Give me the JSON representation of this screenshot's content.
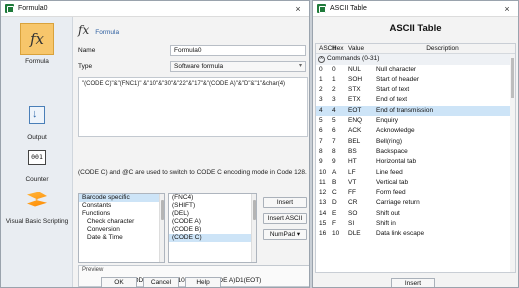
{
  "formula_window": {
    "title": "Formula0",
    "close": "×",
    "rail": [
      {
        "label": "Formula"
      },
      {
        "label": "Output"
      },
      {
        "label": "Counter",
        "icon_text": "001"
      },
      {
        "label": "Visual Basic Scripting"
      }
    ],
    "header": {
      "fx": "fx",
      "title": "Formula"
    },
    "name_label": "Name",
    "name_value": "Formula0",
    "type_label": "Type",
    "type_value": "Software formula",
    "formula": "\"(CODE C)\"&\"(FNC1)\" &\"10\"&\"30\"&\"22\"&\"17\"&\"(CODE A)\"&\"D\"&\"1\"&char(4)",
    "hint": "(CODE C) and @C are used to switch to CODE C encoding mode in Code 128.",
    "categories": [
      "Barcode specific",
      "Constants",
      "Functions",
      "Check character",
      "Conversion",
      "Date & Time"
    ],
    "functions": [
      "(FNC4)",
      "(SHIFT)",
      "(DEL)",
      "(CODE A)",
      "(CODE B)",
      "(CODE C)"
    ],
    "insert_label": "Insert",
    "insert_ascii_label": "Insert ASCII",
    "numpad_label": "NumPad",
    "preview_label": "Preview",
    "preview_value": "(CODE C)(FNC1)10302217(CODE A)D1(EOT)",
    "ok_label": "OK",
    "cancel_label": "Cancel",
    "help_label": "Help"
  },
  "ascii_window": {
    "title": "ASCII Table",
    "close": "×",
    "heading": "ASCII Table",
    "columns": [
      "ASCII",
      "Hex",
      "Value",
      "Description"
    ],
    "group": "Commands (0-31)",
    "rows": [
      [
        "0",
        "0",
        "NUL",
        "Null character"
      ],
      [
        "1",
        "1",
        "SOH",
        "Start of header"
      ],
      [
        "2",
        "2",
        "STX",
        "Start of text"
      ],
      [
        "3",
        "3",
        "ETX",
        "End of text"
      ],
      [
        "4",
        "4",
        "EOT",
        "End of transmission"
      ],
      [
        "5",
        "5",
        "ENQ",
        "Enquiry"
      ],
      [
        "6",
        "6",
        "ACK",
        "Acknowledge"
      ],
      [
        "7",
        "7",
        "BEL",
        "Bell(ring)"
      ],
      [
        "8",
        "8",
        "BS",
        "Backspace"
      ],
      [
        "9",
        "9",
        "HT",
        "Horizontal tab"
      ],
      [
        "10",
        "A",
        "LF",
        "Line feed"
      ],
      [
        "11",
        "B",
        "VT",
        "Vertical tab"
      ],
      [
        "12",
        "C",
        "FF",
        "Form feed"
      ],
      [
        "13",
        "D",
        "CR",
        "Carriage return"
      ],
      [
        "14",
        "E",
        "SO",
        "Shift out"
      ],
      [
        "15",
        "F",
        "SI",
        "Shift in"
      ],
      [
        "16",
        "10",
        "DLE",
        "Data link escape"
      ]
    ],
    "insert_label": "Insert"
  }
}
